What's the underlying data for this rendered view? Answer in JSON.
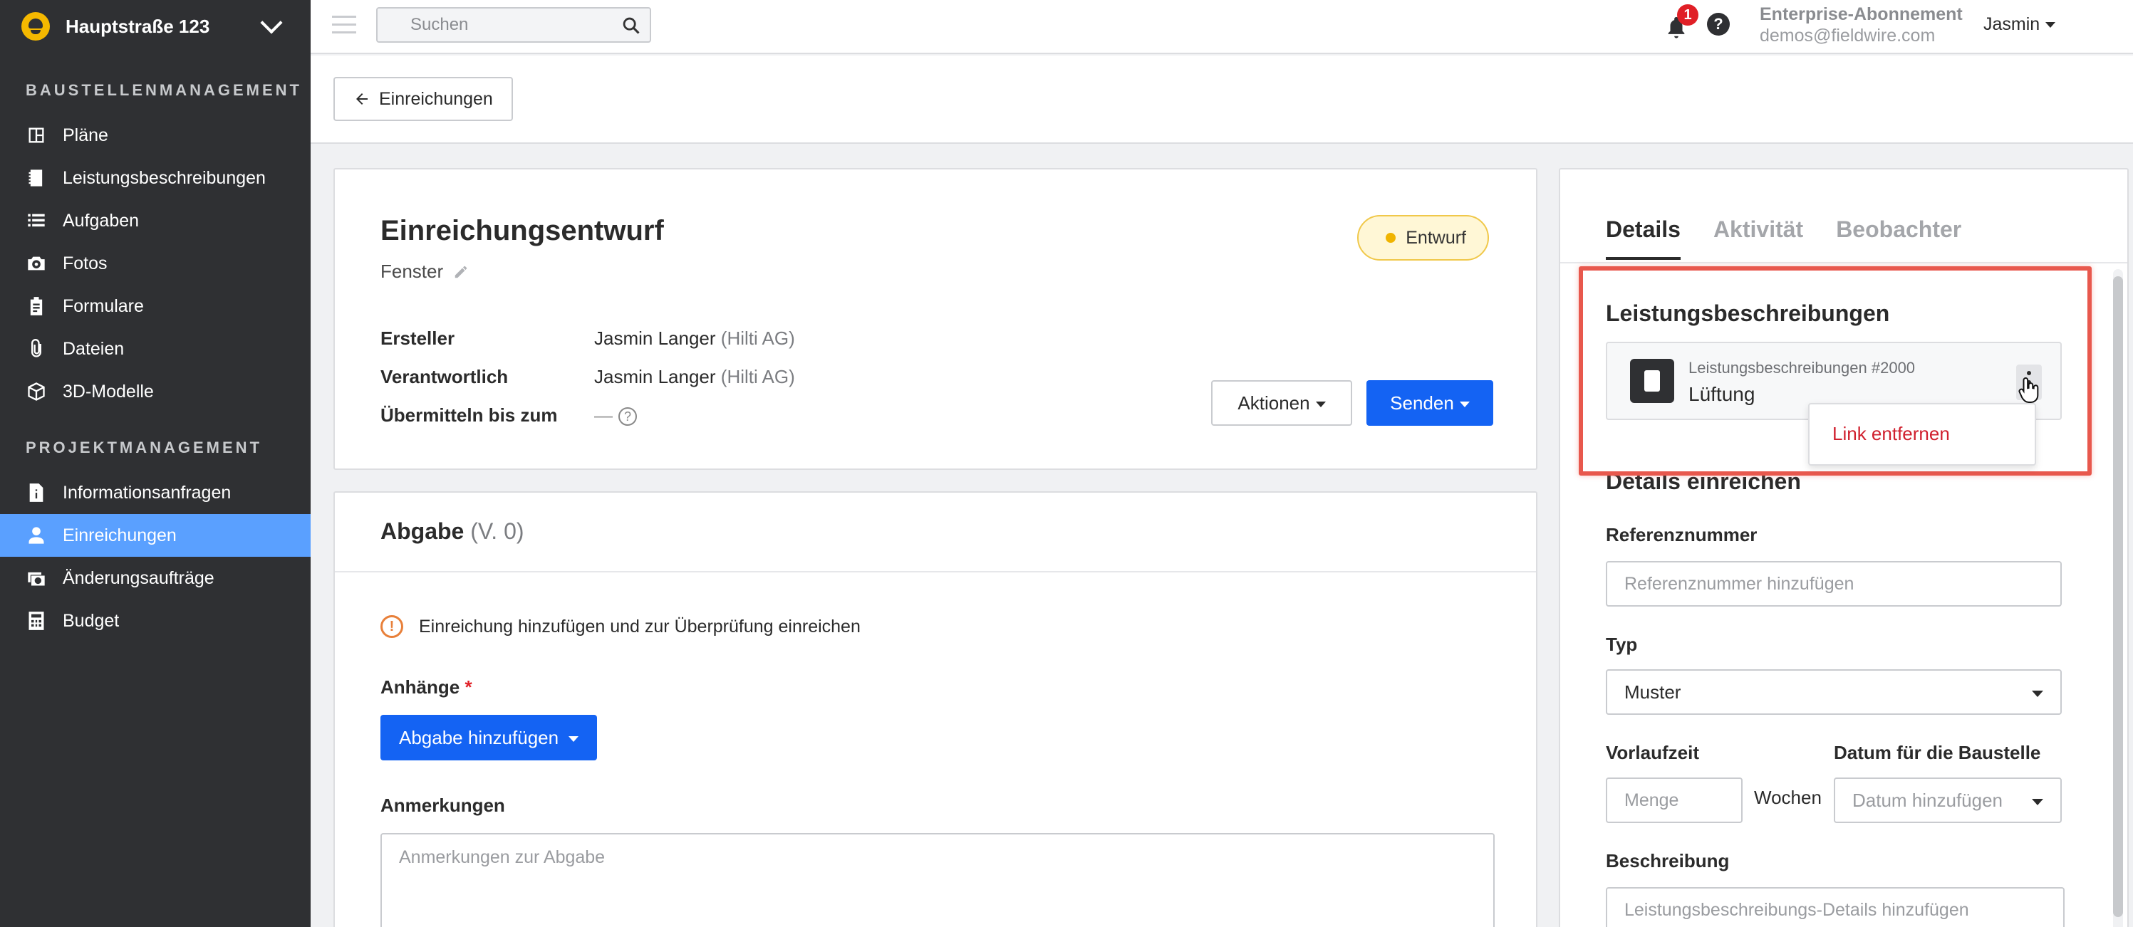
{
  "sidebar": {
    "project": "Hauptstraße 123",
    "section1": "BAUSTELLENMANAGEMENT",
    "items1": [
      {
        "label": "Pläne",
        "icon": "plans-icon"
      },
      {
        "label": "Leistungsbeschreibungen",
        "icon": "specs-icon"
      },
      {
        "label": "Aufgaben",
        "icon": "tasks-icon"
      },
      {
        "label": "Fotos",
        "icon": "camera-icon"
      },
      {
        "label": "Formulare",
        "icon": "forms-icon"
      },
      {
        "label": "Dateien",
        "icon": "paperclip-icon"
      },
      {
        "label": "3D-Modelle",
        "icon": "cube-icon"
      }
    ],
    "section2": "PROJEKTMANAGEMENT",
    "items2": [
      {
        "label": "Informationsanfragen",
        "icon": "rfi-icon"
      },
      {
        "label": "Einreichungen",
        "icon": "submittal-icon",
        "active": true
      },
      {
        "label": "Änderungsaufträge",
        "icon": "change-order-icon"
      },
      {
        "label": "Budget",
        "icon": "calculator-icon"
      }
    ]
  },
  "topbar": {
    "search_placeholder": "Suchen",
    "notification_count": "1",
    "help": "?",
    "subscription": "Enterprise-Abonnement",
    "email": "demos@fieldwire.com",
    "user": "Jasmin"
  },
  "pagehead": {
    "back_label": "Einreichungen"
  },
  "submittal": {
    "title": "Einreichungsentwurf",
    "subtitle": "Fenster",
    "status": "Entwurf",
    "fields": [
      {
        "key": "Ersteller",
        "value": "Jasmin Langer",
        "org": "(Hilti AG)"
      },
      {
        "key": "Verantwortlich",
        "value": "Jasmin Langer",
        "org": "(Hilti AG)"
      },
      {
        "key": "Übermitteln bis zum",
        "value": "—",
        "org": ""
      }
    ],
    "actions_label": "Aktionen",
    "send_label": "Senden"
  },
  "abgabe": {
    "title": "Abgabe",
    "version": "(V. 0)",
    "info": "Einreichung hinzufügen und zur Überprüfung einreichen",
    "attachments_label": "Anhänge",
    "required_mark": "*",
    "add_button": "Abgabe hinzufügen",
    "notes_label": "Anmerkungen",
    "notes_placeholder": "Anmerkungen zur Abgabe"
  },
  "details": {
    "tabs": [
      "Details",
      "Aktivität",
      "Beobachter"
    ],
    "specs_heading": "Leistungsbeschreibungen",
    "spec_number": "Leistungsbeschreibungen #2000",
    "spec_name": "Lüftung",
    "menu_item": "Link entfernen",
    "submit_heading": "Details einreichen",
    "ref_label": "Referenznummer",
    "ref_placeholder": "Referenznummer hinzufügen",
    "type_label": "Typ",
    "type_value": "Muster",
    "lead_label": "Vorlaufzeit",
    "lead_placeholder": "Menge",
    "weeks": "Wochen",
    "date_label": "Datum für die Baustelle",
    "date_placeholder": "Datum hinzufügen",
    "desc_label": "Beschreibung",
    "desc_placeholder": "Leistungsbeschreibungs-Details hinzufügen"
  },
  "colors": {
    "sidebar_bg": "#2f3033",
    "active_nav": "#5aa0ff",
    "primary_button": "#1463f3",
    "highlight_border": "#e8584d",
    "danger_text": "#d0202e"
  }
}
